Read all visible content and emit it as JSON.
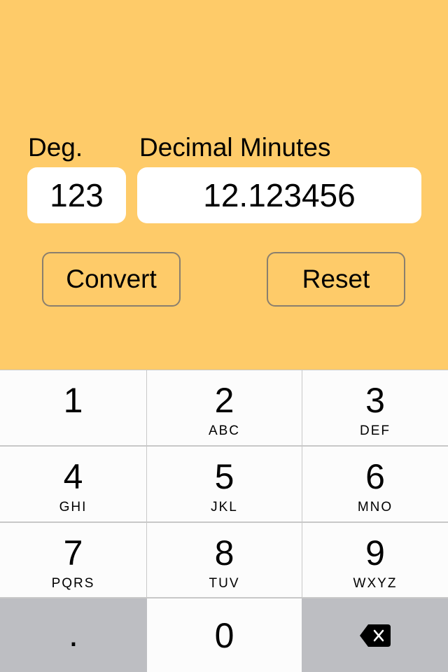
{
  "form": {
    "degrees_label": "Deg.",
    "minutes_label": "Decimal Minutes",
    "degrees_value": "123",
    "minutes_value": "12.123456",
    "convert_label": "Convert",
    "reset_label": "Reset"
  },
  "keypad": {
    "keys": [
      {
        "digit": "1",
        "letters": ""
      },
      {
        "digit": "2",
        "letters": "ABC"
      },
      {
        "digit": "3",
        "letters": "DEF"
      },
      {
        "digit": "4",
        "letters": "GHI"
      },
      {
        "digit": "5",
        "letters": "JKL"
      },
      {
        "digit": "6",
        "letters": "MNO"
      },
      {
        "digit": "7",
        "letters": "PQRS"
      },
      {
        "digit": "8",
        "letters": "TUV"
      },
      {
        "digit": "9",
        "letters": "WXYZ"
      }
    ],
    "decimal": ".",
    "zero": "0",
    "delete_icon": "backspace-icon"
  },
  "colors": {
    "background": "#fecb69",
    "key": "#fcfcfc",
    "key_gray": "#bdbec2"
  }
}
